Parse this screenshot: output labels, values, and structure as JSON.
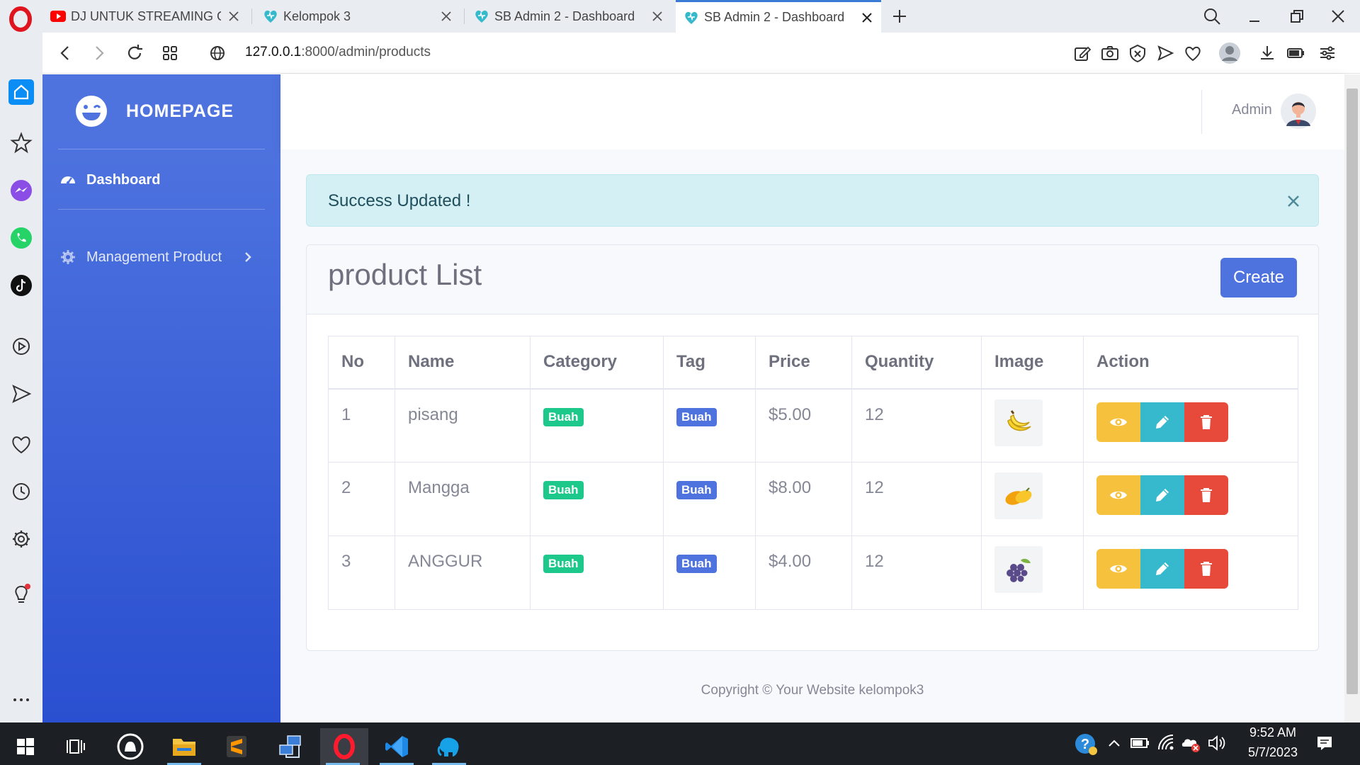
{
  "browser": {
    "tabs": [
      {
        "title": "DJ UNTUK STREAMING GAME",
        "favicon": "youtube-icon",
        "active": false
      },
      {
        "title": "Kelompok 3",
        "favicon": "heart-favicon-icon",
        "active": false
      },
      {
        "title": "SB Admin 2 - Dashboard",
        "favicon": "heart-favicon-icon",
        "active": false
      },
      {
        "title": "SB Admin 2 - Dashboard",
        "favicon": "heart-favicon-icon",
        "active": true
      }
    ],
    "url_host": "127.0.0.1",
    "url_rest": ":8000/admin/products"
  },
  "sidebar": {
    "brand": "HOMEPAGE",
    "items": [
      {
        "label": "Dashboard",
        "icon": "tachometer-icon",
        "active": true
      },
      {
        "label": "Management Product",
        "icon": "cog-icon",
        "active": false
      }
    ],
    "color": "#4e73df"
  },
  "topbar": {
    "user_name": "Admin"
  },
  "alert": {
    "text": "Success Updated !"
  },
  "card": {
    "title": "product List",
    "create_label": "Create"
  },
  "table": {
    "headers": [
      "No",
      "Name",
      "Category",
      "Tag",
      "Price",
      "Quantity",
      "Image",
      "Action"
    ],
    "rows": [
      {
        "no": "1",
        "name": "pisang",
        "category": "Buah",
        "tag": "Buah",
        "price": "$5.00",
        "quantity": "12",
        "image": "banana-image"
      },
      {
        "no": "2",
        "name": "Mangga",
        "category": "Buah",
        "tag": "Buah",
        "price": "$8.00",
        "quantity": "12",
        "image": "mango-image"
      },
      {
        "no": "3",
        "name": "ANGGUR",
        "category": "Buah",
        "tag": "Buah",
        "price": "$4.00",
        "quantity": "12",
        "image": "grapes-image"
      }
    ]
  },
  "footer": {
    "text": "Copyright © Your Website kelompok3"
  },
  "taskbar": {
    "time": "9:52 AM",
    "date": "5/7/2023"
  },
  "colors": {
    "primary": "#4e73df",
    "success": "#1cc88a",
    "warning": "#f6c23e",
    "info": "#36b9cc",
    "danger": "#e74a3b",
    "alert_bg": "#d4f0f5"
  }
}
